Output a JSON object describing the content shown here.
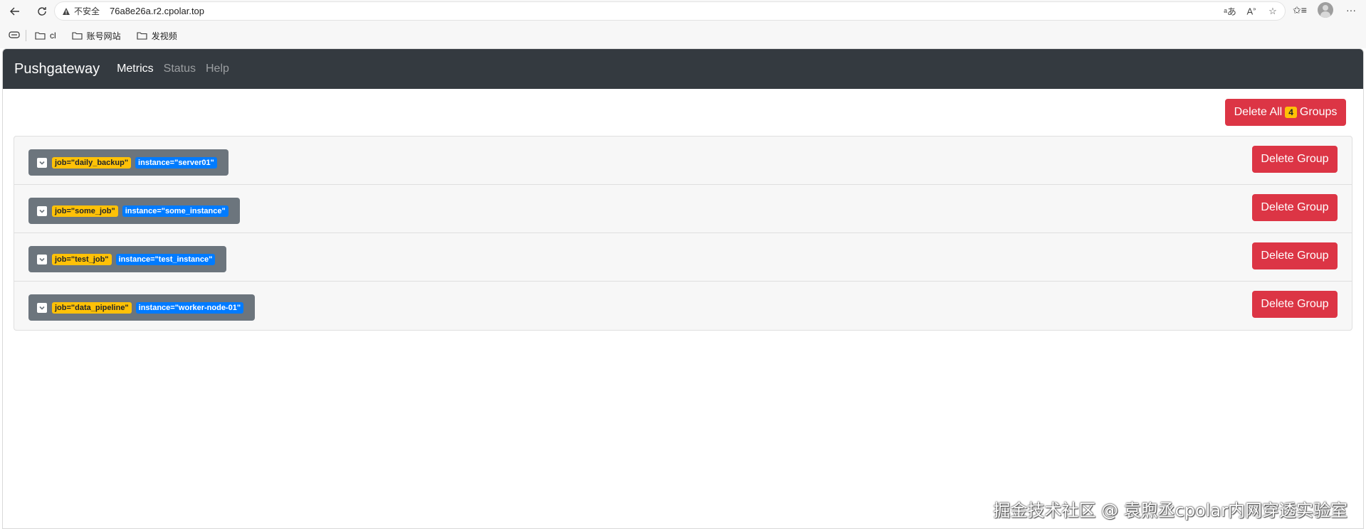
{
  "browser": {
    "security_label": "不安全",
    "url": "76a8e26a.r2.cpolar.top",
    "bookmarks": [
      {
        "label": "cl"
      },
      {
        "label": "账号网站"
      },
      {
        "label": "发视频"
      }
    ]
  },
  "navbar": {
    "brand": "Pushgateway",
    "links": [
      {
        "label": "Metrics",
        "active": true
      },
      {
        "label": "Status",
        "active": false
      },
      {
        "label": "Help",
        "active": false
      }
    ]
  },
  "toolbar": {
    "delete_all_prefix": "Delete All",
    "group_count": "4",
    "delete_all_suffix": "Groups"
  },
  "groups": [
    {
      "job": "job=\"daily_backup\"",
      "instance": "instance=\"server01\"",
      "delete_label": "Delete Group"
    },
    {
      "job": "job=\"some_job\"",
      "instance": "instance=\"some_instance\"",
      "delete_label": "Delete Group"
    },
    {
      "job": "job=\"test_job\"",
      "instance": "instance=\"test_instance\"",
      "delete_label": "Delete Group"
    },
    {
      "job": "job=\"data_pipeline\"",
      "instance": "instance=\"worker-node-01\"",
      "delete_label": "Delete Group"
    }
  ],
  "watermark": "掘金技术社区 @ 袁煦丞cpolar内网穿透实验室",
  "colors": {
    "navbar": "#343a40",
    "danger": "#dc3545",
    "warning": "#ffc107",
    "primary": "#007bff",
    "secondary": "#6c757d"
  }
}
